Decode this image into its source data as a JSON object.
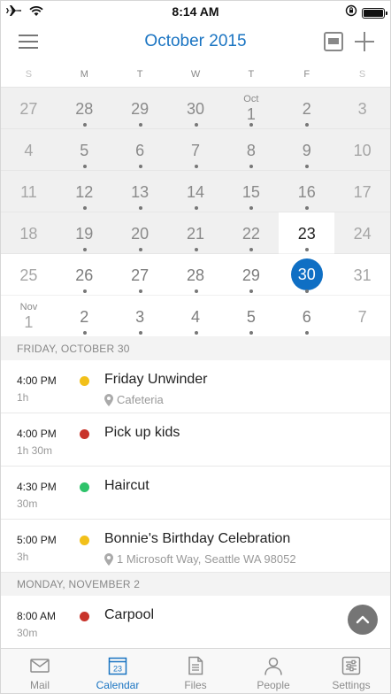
{
  "status_bar": {
    "time": "8:14 AM",
    "icons": [
      "airplane-icon",
      "wifi-icon",
      "orientation-lock-icon",
      "battery-icon"
    ]
  },
  "header": {
    "title": "October 2015",
    "menu_icon": "hamburger-icon",
    "view_icon": "agenda-view-icon",
    "add_icon": "plus-icon"
  },
  "weekdays": [
    "S",
    "M",
    "T",
    "W",
    "T",
    "F",
    "S"
  ],
  "calendar": {
    "weeks": [
      [
        {
          "d": "27"
        },
        {
          "d": "28"
        },
        {
          "d": "29"
        },
        {
          "d": "30"
        },
        {
          "d": "1",
          "m": "Oct"
        },
        {
          "d": "2"
        },
        {
          "d": "3"
        }
      ],
      [
        {
          "d": "4"
        },
        {
          "d": "5"
        },
        {
          "d": "6"
        },
        {
          "d": "7"
        },
        {
          "d": "8"
        },
        {
          "d": "9"
        },
        {
          "d": "10"
        }
      ],
      [
        {
          "d": "11"
        },
        {
          "d": "12"
        },
        {
          "d": "13"
        },
        {
          "d": "14"
        },
        {
          "d": "15"
        },
        {
          "d": "16"
        },
        {
          "d": "17"
        }
      ],
      [
        {
          "d": "18"
        },
        {
          "d": "19"
        },
        {
          "d": "20"
        },
        {
          "d": "21"
        },
        {
          "d": "22"
        },
        {
          "d": "23"
        },
        {
          "d": "24"
        }
      ],
      [
        {
          "d": "25"
        },
        {
          "d": "26"
        },
        {
          "d": "27"
        },
        {
          "d": "28"
        },
        {
          "d": "29"
        },
        {
          "d": "30"
        },
        {
          "d": "31"
        }
      ],
      [
        {
          "d": "1",
          "m": "Nov"
        },
        {
          "d": "2"
        },
        {
          "d": "3"
        },
        {
          "d": "4"
        },
        {
          "d": "5"
        },
        {
          "d": "6"
        },
        {
          "d": "7"
        }
      ]
    ],
    "today": "23",
    "selected": "30",
    "accent_color": "#0f6fc4"
  },
  "agenda": {
    "sections": [
      {
        "heading": "FRIDAY, OCTOBER 30",
        "events": [
          {
            "time": "4:00 PM",
            "duration": "1h",
            "title": "Friday Unwinder",
            "location": "Cafeteria",
            "color": "#f2c01a"
          },
          {
            "time": "4:00 PM",
            "duration": "1h 30m",
            "title": "Pick up kids",
            "location": "",
            "color": "#c8342b"
          },
          {
            "time": "4:30 PM",
            "duration": "30m",
            "title": "Haircut",
            "location": "",
            "color": "#2ec36a"
          },
          {
            "time": "5:00 PM",
            "duration": "3h",
            "title": "Bonnie's Birthday Celebration",
            "location": "1 Microsoft Way, Seattle WA 98052",
            "color": "#f2c01a"
          }
        ]
      },
      {
        "heading": "MONDAY, NOVEMBER 2",
        "events": [
          {
            "time": "8:00 AM",
            "duration": "30m",
            "title": "Carpool",
            "location": "",
            "color": "#c8342b"
          }
        ]
      }
    ]
  },
  "scroll_button_icon": "chevron-up-icon",
  "tabs": [
    {
      "label": "Mail",
      "icon": "mail-icon",
      "active": false
    },
    {
      "label": "Calendar",
      "icon": "calendar-icon",
      "active": true,
      "icon_text": "23"
    },
    {
      "label": "Files",
      "icon": "file-icon",
      "active": false
    },
    {
      "label": "People",
      "icon": "person-icon",
      "active": false
    },
    {
      "label": "Settings",
      "icon": "settings-icon",
      "active": false
    }
  ]
}
